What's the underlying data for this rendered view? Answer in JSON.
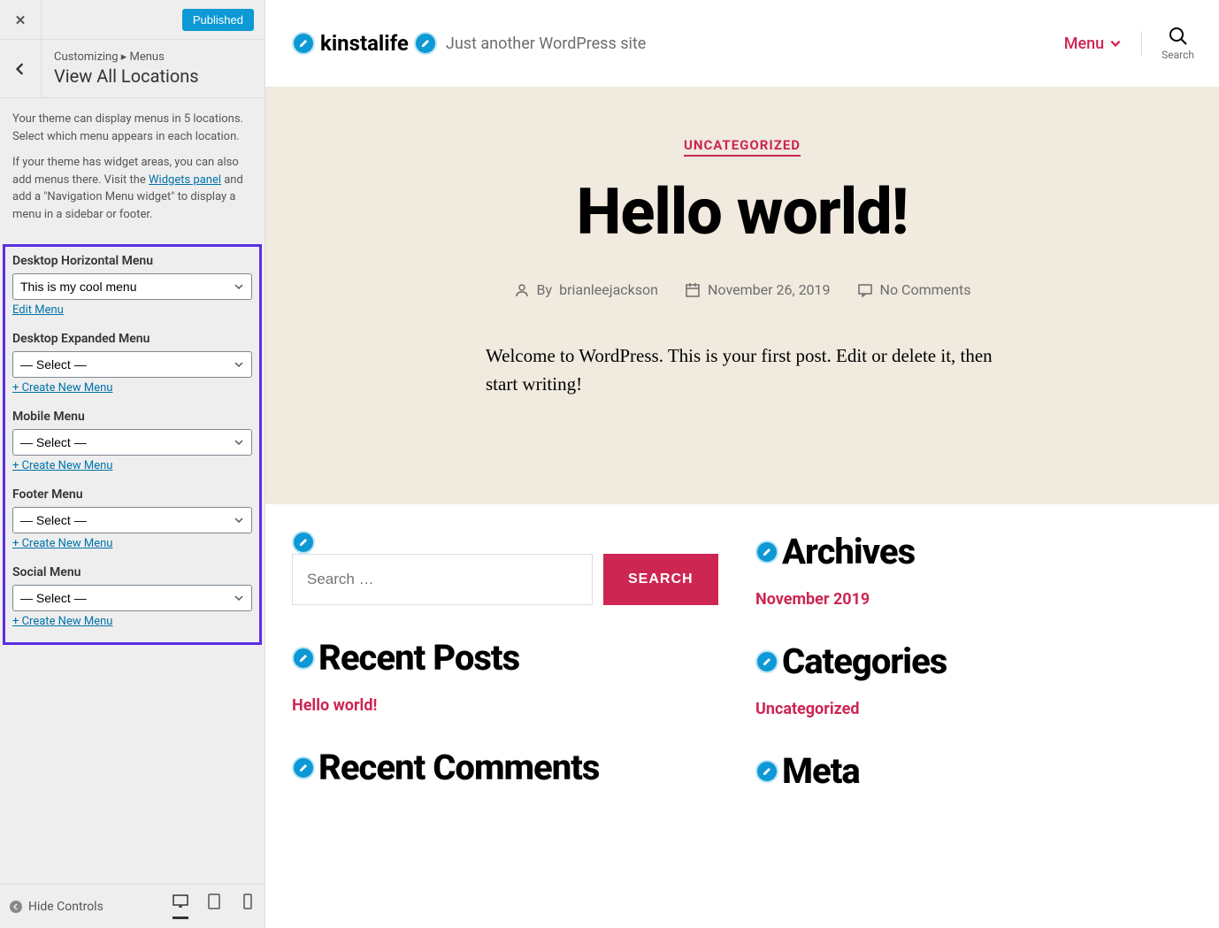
{
  "customizer": {
    "published_label": "Published",
    "breadcrumb": "Customizing ▸ Menus",
    "panel_title": "View All Locations",
    "desc1": "Your theme can display menus in 5 locations. Select which menu appears in each location.",
    "desc2a": "If your theme has widget areas, you can also add menus there. Visit the ",
    "desc2link": "Widgets panel",
    "desc2b": " and add a \"Navigation Menu widget\" to display a menu in a sidebar or footer.",
    "locations": [
      {
        "label": "Desktop Horizontal Menu",
        "value": "This is my cool menu",
        "action": "Edit Menu"
      },
      {
        "label": "Desktop Expanded Menu",
        "value": "— Select —",
        "action": "+ Create New Menu"
      },
      {
        "label": "Mobile Menu",
        "value": "— Select —",
        "action": "+ Create New Menu"
      },
      {
        "label": "Footer Menu",
        "value": "— Select —",
        "action": "+ Create New Menu"
      },
      {
        "label": "Social Menu",
        "value": "— Select —",
        "action": "+ Create New Menu"
      }
    ],
    "hide_controls": "Hide Controls"
  },
  "preview": {
    "site_title": "kinstalife",
    "tagline": "Just another WordPress site",
    "menu_label": "Menu",
    "search_label": "Search",
    "category": "UNCATEGORIZED",
    "post_title": "Hello world!",
    "by_label": "By",
    "author": "brianleejackson",
    "date": "November 26, 2019",
    "comments": "No Comments",
    "body": "Welcome to WordPress. This is your first post. Edit or delete it, then start writing!",
    "search_placeholder": "Search …",
    "search_btn": "SEARCH",
    "widgets": {
      "recent_posts": "Recent Posts",
      "recent_posts_item": "Hello world!",
      "recent_comments": "Recent Comments",
      "archives": "Archives",
      "archives_item": "November 2019",
      "categories": "Categories",
      "categories_item": "Uncategorized",
      "meta": "Meta"
    }
  }
}
